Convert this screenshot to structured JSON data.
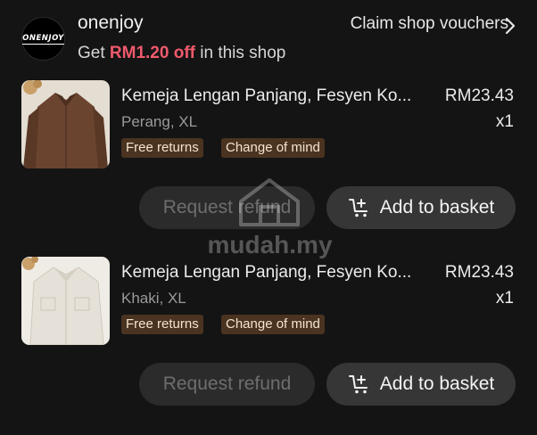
{
  "shop": {
    "logo_text": "ONENJOY",
    "name": "onenjoy",
    "promo_prefix": "Get",
    "promo_amount": "RM1.20 off",
    "promo_suffix": "in this shop",
    "claim_label": "Claim shop vouchers",
    "claim_icon": "chevron-right-icon"
  },
  "items": [
    {
      "title": "Kemeja Lengan Panjang, Fesyen Ko...",
      "variant": "Perang, XL",
      "price": "RM23.43",
      "qty": "x1",
      "tags": [
        "Free returns",
        "Change of mind"
      ],
      "refund_label": "Request refund",
      "basket_label": "Add to basket",
      "basket_icon": "cart-plus-icon",
      "shirt_color": "#6b4430"
    },
    {
      "title": "Kemeja Lengan Panjang, Fesyen Ko...",
      "variant": "Khaki, XL",
      "price": "RM23.43",
      "qty": "x1",
      "tags": [
        "Free returns",
        "Change of mind"
      ],
      "refund_label": "Request refund",
      "basket_label": "Add to basket",
      "basket_icon": "cart-plus-icon",
      "shirt_color": "#e6e1d8"
    }
  ],
  "watermark": "mudah.my",
  "colors": {
    "background": "#141414",
    "promo_accent": "#f05a6c",
    "tag_bg": "#4a3320",
    "tag_text": "#f4e4cf"
  }
}
